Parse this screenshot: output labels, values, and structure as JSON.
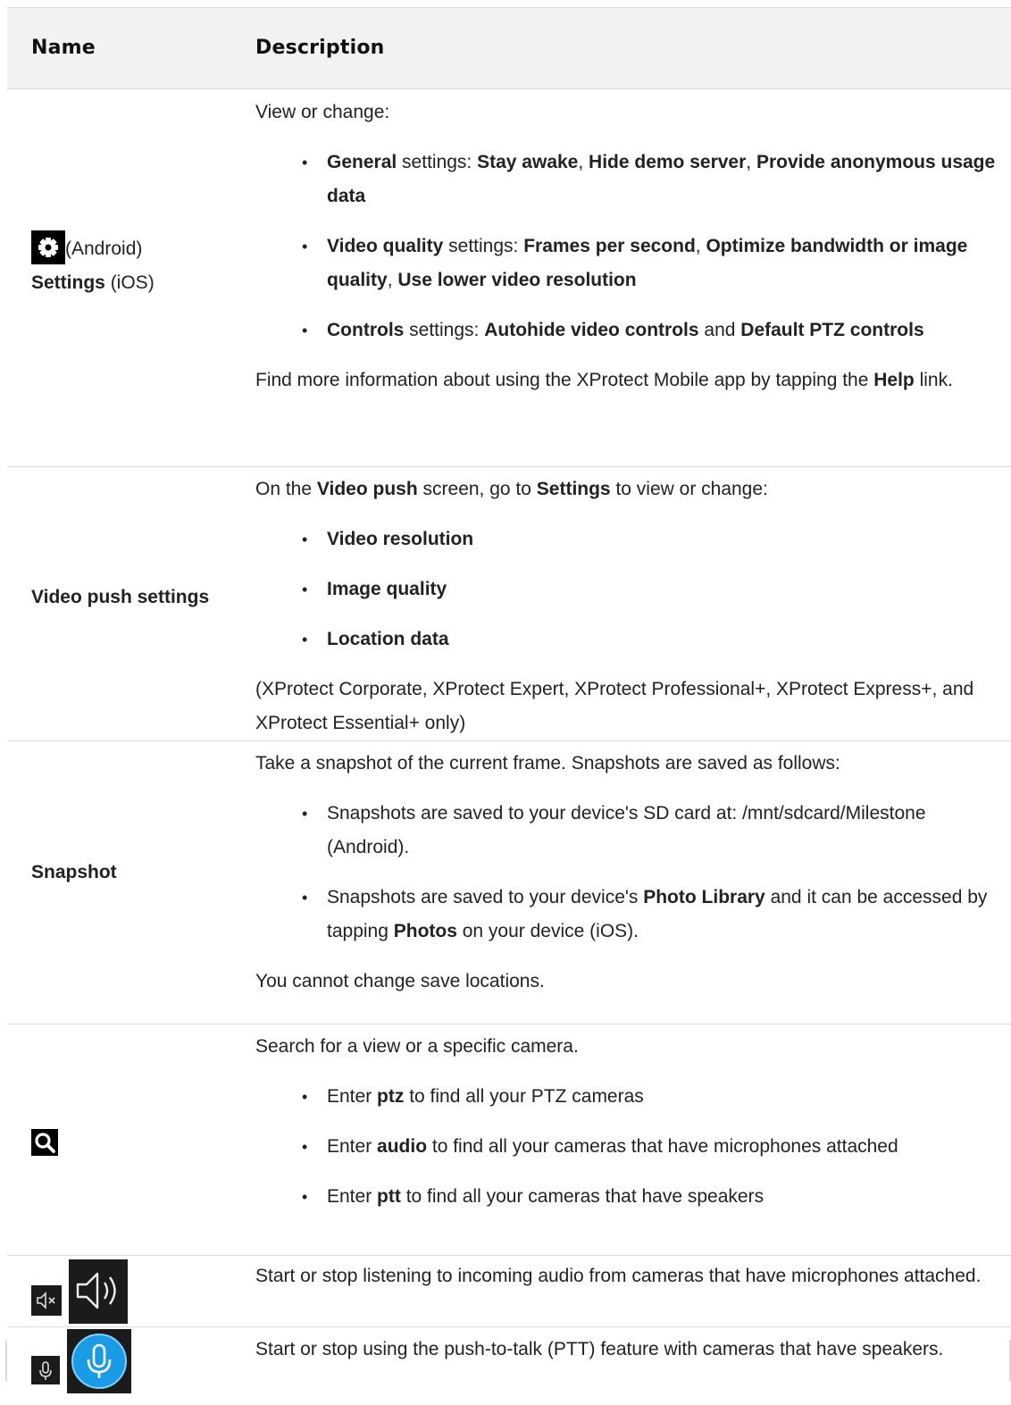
{
  "header": {
    "name": "Name",
    "description": "Description"
  },
  "row1": {
    "name_suffix": "(Android)",
    "name_bold": "Settings",
    "name_ios": "(iOS)",
    "intro": "View or change:",
    "b1_bold1": "General",
    "b1_t1": " settings: ",
    "b1_bold2": "Stay awake",
    "b1_t2": ", ",
    "b1_bold3": "Hide demo server",
    "b1_t3": ", ",
    "b1_bold4": "Provide anonymous usage data",
    "b2_bold1": "Video quality",
    "b2_t1": " settings: ",
    "b2_bold2": "Frames per second",
    "b2_t2": ", ",
    "b2_bold3": "Optimize bandwidth or image quality",
    "b2_t3": ", ",
    "b2_bold4": "Use lower video resolution",
    "b3_bold1": "Controls",
    "b3_t1": " settings: ",
    "b3_bold2": "Autohide video controls",
    "b3_t2": " and ",
    "b3_bold3": "Default PTZ controls",
    "footer_t1": "Find more information about using the XProtect Mobile app by tapping the ",
    "footer_bold": "Help",
    "footer_t2": " link."
  },
  "row2": {
    "name": "Video push settings",
    "intro_t1": "On the ",
    "intro_b1": "Video push",
    "intro_t2": " screen, go to ",
    "intro_b2": "Settings",
    "intro_t3": " to view or change:",
    "items": [
      "Video resolution",
      "Image quality",
      "Location data"
    ],
    "footer": "(XProtect Corporate, XProtect Expert, XProtect Professional+, XProtect Express+, and XProtect Essential+ only)"
  },
  "row3": {
    "name": "Snapshot",
    "intro": "Take a snapshot of the current frame. Snapshots are saved as follows:",
    "b1": "Snapshots are saved to your device's SD card at: /mnt/sdcard/Milestone (Android).",
    "b2_t1": "Snapshots are saved to your device's ",
    "b2_b1": "Photo Library",
    "b2_t2": " and it can be accessed by tapping ",
    "b2_b2": "Photos",
    "b2_t3": " on your device (iOS).",
    "footer": "You cannot change save locations."
  },
  "row4": {
    "intro": "Search for a view or a specific camera.",
    "b1_t1": "Enter ",
    "b1_b": "ptz",
    "b1_t2": " to find all your PTZ cameras",
    "b2_t1": "Enter ",
    "b2_b": "audio",
    "b2_t2": " to find all your cameras that have microphones attached",
    "b3_t1": "Enter ",
    "b3_b": "ptt",
    "b3_t2": " to find all your cameras that have speakers"
  },
  "row5": {
    "desc": "Start or stop listening to incoming audio from cameras that have microphones attached."
  },
  "row6": {
    "desc": "Start or stop using the push-to-talk (PTT) feature with cameras that have speakers."
  },
  "colors": {
    "header_bg": "#f2f2f2",
    "border": "#d9d9d9",
    "mic_active": "#1a9be6"
  }
}
